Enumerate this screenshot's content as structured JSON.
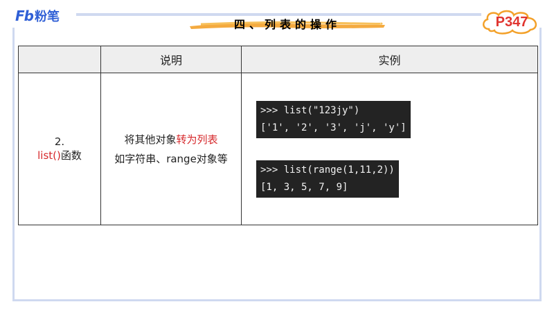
{
  "brand": {
    "logo_latin": "Fb",
    "logo_cn": "粉笔"
  },
  "header": {
    "title": "四、列表的操作",
    "page_label": "P347"
  },
  "table": {
    "columns": [
      "",
      "说明",
      "实例"
    ],
    "row": {
      "index": "2.",
      "func_name": "list()",
      "func_suffix": "函数",
      "desc_line1_prefix": "将其他对象",
      "desc_line1_highlight": "转为列表",
      "desc_line2": "如字符串、range对象等",
      "examples": [
        {
          "code": ">>> list(\"123jy\")",
          "output": "['1', '2', '3', 'j', 'y']"
        },
        {
          "code": ">>> list(range(1,11,2))",
          "output": "[1, 3, 5, 7, 9]"
        }
      ]
    }
  },
  "colors": {
    "accent_red": "#d6282b",
    "brand_blue": "#2f5fd6",
    "header_gray": "#eeeeee",
    "code_bg": "#232323"
  }
}
